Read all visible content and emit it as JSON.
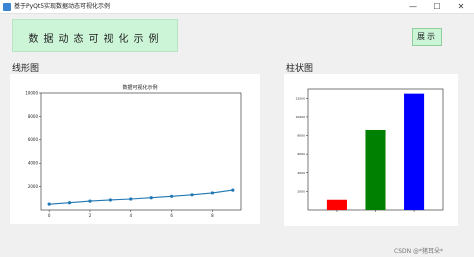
{
  "window": {
    "title": "基于PyQt5实现数据动态可视化示例",
    "controls": {
      "minimize": "—",
      "maximize": "☐",
      "close": "✕"
    }
  },
  "header": {
    "banner_text": "数据动态可视化示例",
    "show_button": "展示"
  },
  "sections": {
    "line": "线形图",
    "bar": "柱状图"
  },
  "colors": {
    "banner_bg": "#ccf5d8",
    "line": "#1f77b4",
    "bars": [
      "#ff0000",
      "#008000",
      "#0000ff"
    ]
  },
  "chart_data": [
    {
      "type": "line",
      "title": "数据可视化示例",
      "xlabel": "",
      "ylabel": "",
      "x": [
        0,
        1,
        2,
        3,
        4,
        5,
        6,
        7,
        8,
        9
      ],
      "y": [
        500,
        620,
        760,
        860,
        940,
        1050,
        1170,
        1300,
        1460,
        1700
      ],
      "xlim": [
        -0.4,
        9.4
      ],
      "ylim": [
        0,
        10000
      ],
      "xticks": [
        0,
        2,
        4,
        6,
        8
      ],
      "yticks": [
        2000,
        4000,
        6000,
        8000,
        10000
      ],
      "grid": false
    },
    {
      "type": "bar",
      "title": "",
      "xlabel": "",
      "ylabel": "",
      "categories": [
        "",
        "",
        ""
      ],
      "values": [
        1100,
        8600,
        12500
      ],
      "ylim": [
        0,
        13000
      ],
      "yticks": [
        2000,
        4000,
        6000,
        8000,
        10000,
        12000
      ],
      "grid": false
    }
  ],
  "watermark": "CSDN @*猪耳朵*"
}
